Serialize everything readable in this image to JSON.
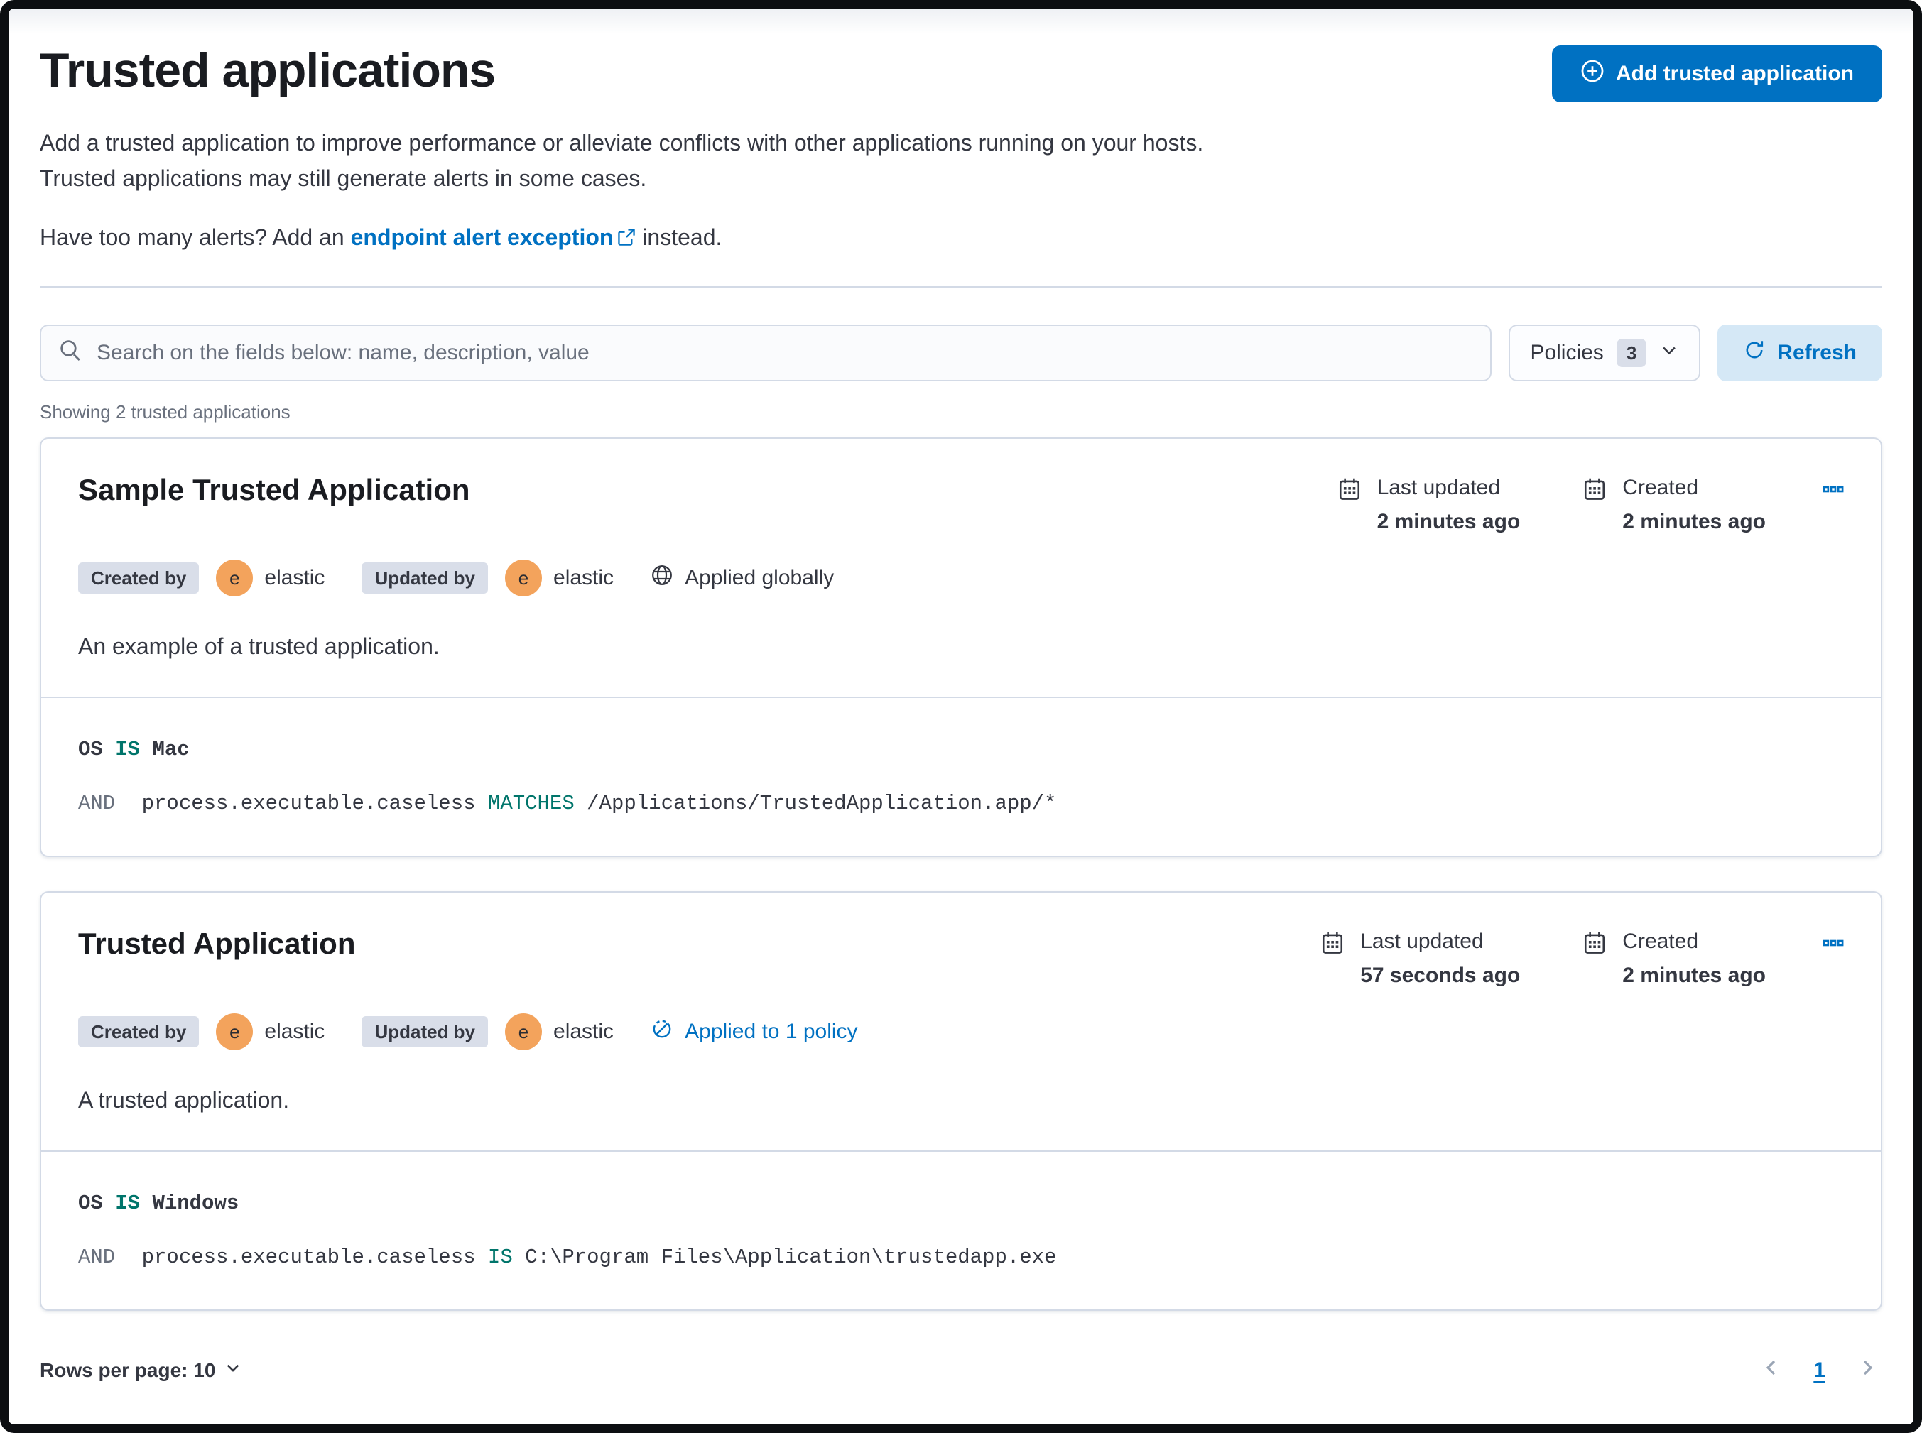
{
  "page": {
    "title": "Trusted applications",
    "add_button_label": "Add trusted application",
    "description": "Add a trusted application to improve performance or alleviate conflicts with other applications running on your hosts. Trusted applications may still generate alerts in some cases.",
    "alerts_prefix": "Have too many alerts? Add an",
    "alerts_link": "endpoint alert exception",
    "alerts_suffix": "instead."
  },
  "toolbar": {
    "search_placeholder": "Search on the fields below: name, description, value",
    "policies_label": "Policies",
    "policies_count": "3",
    "refresh_label": "Refresh"
  },
  "list": {
    "summary": "Showing 2 trusted applications",
    "cards": [
      {
        "title": "Sample Trusted Application",
        "created_by_label": "Created by",
        "created_by_user": "elastic",
        "updated_by_label": "Updated by",
        "updated_by_user": "elastic",
        "avatar_letter": "e",
        "scope_label": "Applied globally",
        "description": "An example of a trusted application.",
        "last_updated_label": "Last updated",
        "last_updated_value": "2 minutes ago",
        "created_label": "Created",
        "created_value": "2 minutes ago",
        "conditions": [
          {
            "prefix": "",
            "field": "OS",
            "operator": "IS",
            "value": "Mac"
          },
          {
            "prefix": "AND",
            "field": "process.executable.caseless",
            "operator": "MATCHES",
            "value": "/Applications/TrustedApplication.app/*"
          }
        ]
      },
      {
        "title": "Trusted Application",
        "created_by_label": "Created by",
        "created_by_user": "elastic",
        "updated_by_label": "Updated by",
        "updated_by_user": "elastic",
        "avatar_letter": "e",
        "scope_label": "Applied to 1 policy",
        "description": "A trusted application.",
        "last_updated_label": "Last updated",
        "last_updated_value": "57 seconds ago",
        "created_label": "Created",
        "created_value": "2 minutes ago",
        "conditions": [
          {
            "prefix": "",
            "field": "OS",
            "operator": "IS",
            "value": "Windows"
          },
          {
            "prefix": "AND",
            "field": "process.executable.caseless",
            "operator": "IS",
            "value": "C:\\Program Files\\Application\\trustedapp.exe"
          }
        ]
      }
    ]
  },
  "footer": {
    "rows_per_page_label": "Rows per page: 10",
    "page_number": "1"
  },
  "colors": {
    "primary": "#0071c2",
    "refresh_bg": "#d5e8f6",
    "badge_bg": "#d9dee9",
    "avatar_bg": "#f3a35c",
    "operator_teal": "#00756b",
    "border": "#d3dae6",
    "text": "#343741",
    "subdued": "#69707d"
  }
}
